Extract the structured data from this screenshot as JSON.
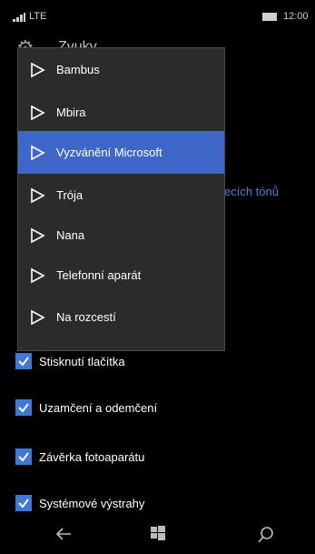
{
  "status_bar": {
    "network": "LTE",
    "time": "12:00"
  },
  "header": {
    "title": "Zvuky"
  },
  "background_partial_text": "ecích tónů",
  "dropdown": {
    "items": [
      {
        "label": "Bambus",
        "selected": false
      },
      {
        "label": "Mbira",
        "selected": false
      },
      {
        "label": "Vyzvánění Microsoft",
        "selected": true
      },
      {
        "label": "Trója",
        "selected": false
      },
      {
        "label": "Nana",
        "selected": false
      },
      {
        "label": "Telefonní aparát",
        "selected": false
      },
      {
        "label": "Na rozcestí",
        "selected": false
      }
    ]
  },
  "checkboxes": [
    {
      "label": "Stisknutí tlačítka",
      "checked": true
    },
    {
      "label": "Uzamčení a odemčení",
      "checked": true
    },
    {
      "label": "Závěrka fotoaparátu",
      "checked": true
    },
    {
      "label": "Systémové výstrahy",
      "checked": true
    }
  ],
  "colors": {
    "accent": "#3f67c8",
    "checkbox": "#3f79d7",
    "menu_bg": "#2b2b2b"
  },
  "nav": {
    "back_icon": "back-arrow-icon",
    "home_icon": "windows-logo-icon",
    "search_icon": "search-icon"
  }
}
